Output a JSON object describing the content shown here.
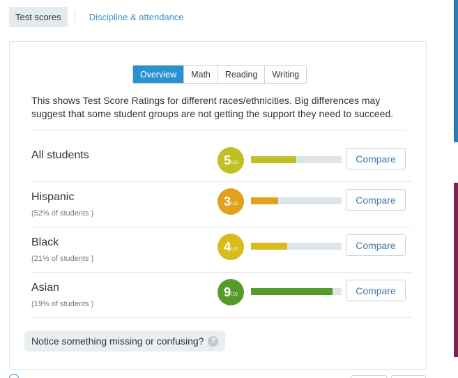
{
  "top_tabs": [
    {
      "label": "Test scores",
      "active": true
    },
    {
      "label": "Discipline & attendance",
      "active": false
    }
  ],
  "subject_tabs": [
    {
      "label": "Overview",
      "active": true
    },
    {
      "label": "Math",
      "active": false
    },
    {
      "label": "Reading",
      "active": false
    },
    {
      "label": "Writing",
      "active": false
    }
  ],
  "description": "This shows Test Score Ratings for different races/ethnicities. Big differences may suggest that some student groups are not getting the support they need to succeed.",
  "rating_denominator": "/10",
  "groups": [
    {
      "name": "All students",
      "share": "",
      "rating": "5",
      "score": 5,
      "color": "#c0c024",
      "compare_label": "Compare"
    },
    {
      "name": "Hispanic",
      "share": "(52% of students )",
      "rating": "3",
      "score": 3,
      "color": "#e0a21c",
      "compare_label": "Compare"
    },
    {
      "name": "Black",
      "share": "(21% of students )",
      "rating": "4",
      "score": 4,
      "color": "#d9bb1a",
      "compare_label": "Compare"
    },
    {
      "name": "Asian",
      "share": "(19% of students )",
      "rating": "9",
      "score": 9,
      "color": "#559b2c",
      "compare_label": "Compare"
    }
  ],
  "feedback": {
    "label": "Notice something missing or confusing?",
    "icon": "help-icon"
  },
  "colors": {
    "accent": "#2a93cf",
    "link": "#3d8fc1",
    "side_blue": "#2a7fb9",
    "side_purple": "#7c2353"
  }
}
